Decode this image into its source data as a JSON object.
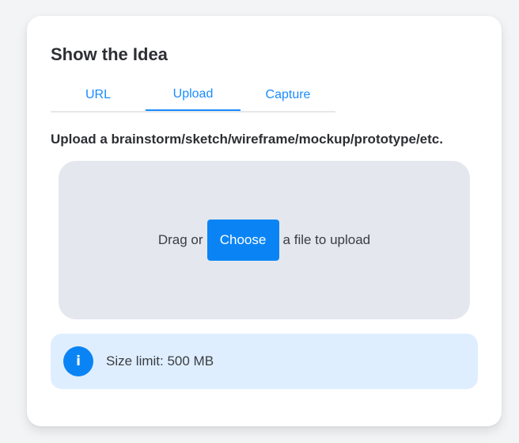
{
  "card": {
    "title": "Show the Idea"
  },
  "tabs": [
    {
      "label": "URL",
      "active": false
    },
    {
      "label": "Upload",
      "active": true
    },
    {
      "label": "Capture",
      "active": false
    }
  ],
  "upload": {
    "heading": "Upload a brainstorm/sketch/wireframe/mockup/prototype/etc.",
    "drag_text": "Drag or",
    "choose_label": "Choose",
    "after_text": "a file to upload"
  },
  "info": {
    "icon_glyph": "i",
    "icon_name": "info-icon",
    "text": "Size limit: 500 MB"
  },
  "colors": {
    "accent": "#0a84f5",
    "dropzone_bg": "#e4e7ee",
    "info_bg": "#dfeeff"
  }
}
